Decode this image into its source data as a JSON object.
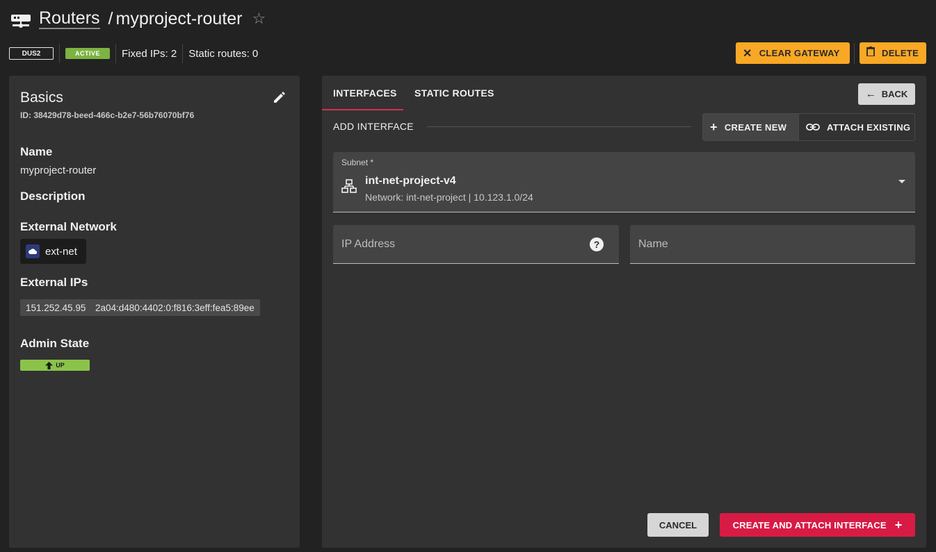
{
  "header": {
    "breadcrumb_link": "Routers",
    "separator": "/",
    "current": "myproject-router",
    "region": "DUS2",
    "status": "ACTIVE",
    "fixed_ips": "Fixed IPs: 2",
    "static_routes": "Static routes: 0",
    "clear_gateway_label": "CLEAR GATEWAY",
    "delete_label": "DELETE",
    "colors": {
      "warning": "#f9a825",
      "active": "#7cb342"
    }
  },
  "basics": {
    "title": "Basics",
    "id": "ID: 38429d78-beed-466c-b2e7-56b76070bf76",
    "name_label": "Name",
    "name_value": "myproject-router",
    "description_label": "Description",
    "external_network_label": "External Network",
    "external_network_value": "ext-net",
    "external_ips_label": "External IPs",
    "external_ips": [
      "151.252.45.95",
      "2a04:d480:4402:0:f816:3eff:fea5:89ee"
    ],
    "admin_state_label": "Admin State",
    "admin_state_value": "UP"
  },
  "tabs": [
    {
      "label": "INTERFACES",
      "active": true
    },
    {
      "label": "STATIC ROUTES",
      "active": false
    }
  ],
  "back_label": "BACK",
  "add_interface": {
    "label": "ADD INTERFACE",
    "create_new_label": "CREATE NEW",
    "attach_existing_label": "ATTACH EXISTING"
  },
  "form": {
    "subnet_label": "Subnet *",
    "subnet_name": "int-net-project-v4",
    "subnet_detail": "Network: int-net-project | 10.123.1.0/24",
    "ip_placeholder": "IP Address",
    "name_placeholder": "Name",
    "cancel_label": "CANCEL",
    "submit_label": "CREATE AND ATTACH INTERFACE",
    "colors": {
      "primary": "#d81b45"
    }
  }
}
